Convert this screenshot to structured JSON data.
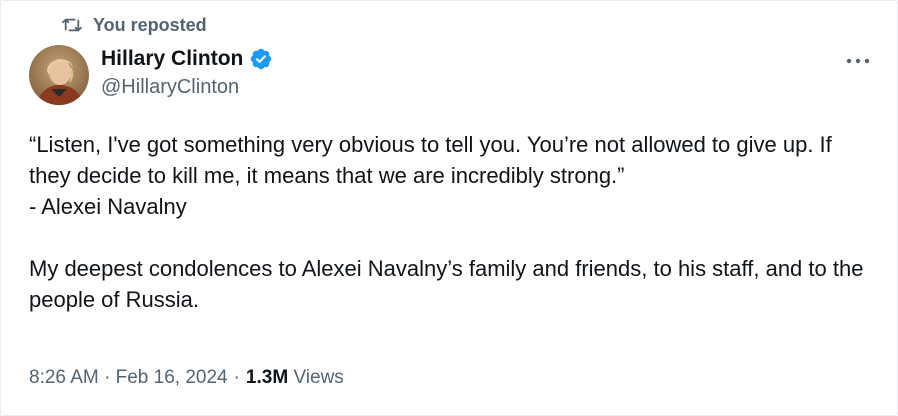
{
  "repost": {
    "label": "You reposted",
    "icon": "repost-icon"
  },
  "author": {
    "display_name": "Hillary Clinton",
    "handle": "@HillaryClinton",
    "verified": true,
    "verified_color": "#1d9bf0",
    "avatar_icon": "avatar"
  },
  "menu": {
    "icon": "more-options-icon",
    "glyph": "···"
  },
  "tweet": {
    "paragraphs": [
      "“Listen, I've got something very obvious to tell you. You’re not allowed to give up. If they decide to kill me, it means that we are incredibly strong.”\n- Alexei Navalny",
      "My deepest condolences to Alexei Navalny’s family and friends, to his staff, and to the people of Russia."
    ]
  },
  "meta": {
    "time": "8:26 AM",
    "separator": "·",
    "date": "Feb 16, 2024",
    "views_count": "1.3M",
    "views_label": "Views"
  },
  "colors": {
    "text_primary": "#0f1419",
    "text_secondary": "#536471",
    "border": "#e6ecf0",
    "accent": "#1d9bf0"
  }
}
